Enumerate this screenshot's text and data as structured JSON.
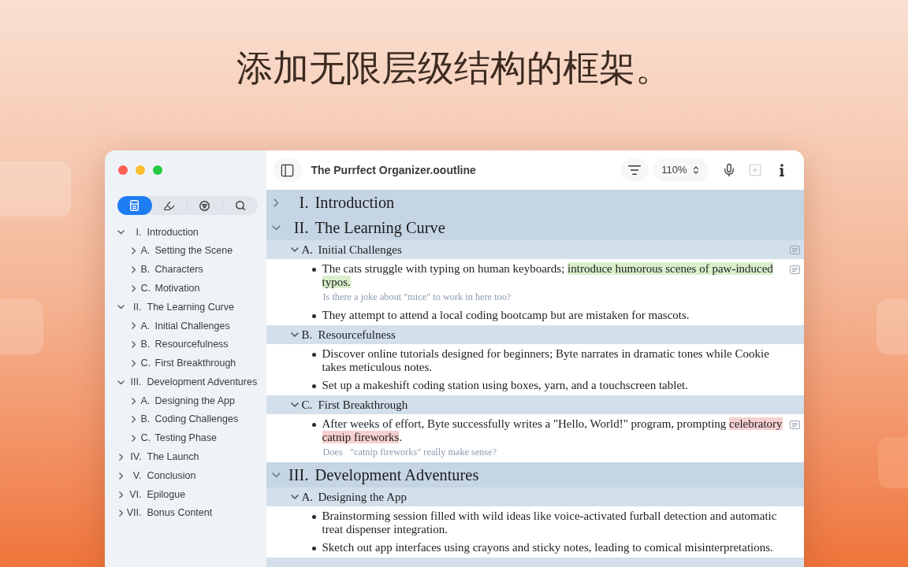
{
  "headline": "添加无限层级结构的框架。",
  "window": {
    "title": "The Purrfect Organizer.ooutline",
    "zoom": "110%",
    "add_button": {
      "disabled": true
    }
  },
  "sidebar": {
    "tabs": [
      {
        "kind": "outline",
        "selected": true
      },
      {
        "kind": "highlights",
        "selected": false
      },
      {
        "kind": "filter",
        "selected": false
      },
      {
        "kind": "search",
        "selected": false
      }
    ],
    "items": [
      {
        "number": "I.",
        "label": "Introduction",
        "expanded": true,
        "children": [
          {
            "number": "A.",
            "label": "Setting the Scene",
            "expanded": false
          },
          {
            "number": "B.",
            "label": "Characters",
            "expanded": false
          },
          {
            "number": "C.",
            "label": "Motivation",
            "expanded": false
          }
        ]
      },
      {
        "number": "II.",
        "label": "The Learning Curve",
        "expanded": true,
        "children": [
          {
            "number": "A.",
            "label": "Initial Challenges",
            "expanded": false
          },
          {
            "number": "B.",
            "label": "Resourcefulness",
            "expanded": false
          },
          {
            "number": "C.",
            "label": "First Breakthrough",
            "expanded": false
          }
        ]
      },
      {
        "number": "III.",
        "label": "Development Adventures",
        "expanded": true,
        "children": [
          {
            "number": "A.",
            "label": "Designing the App",
            "expanded": false
          },
          {
            "number": "B.",
            "label": "Coding Challenges",
            "expanded": false
          },
          {
            "number": "C.",
            "label": "Testing Phase",
            "expanded": false
          }
        ]
      },
      {
        "number": "IV.",
        "label": "The Launch",
        "expanded": false
      },
      {
        "number": "V.",
        "label": "Conclusion",
        "expanded": false
      },
      {
        "number": "VI.",
        "label": "Epilogue",
        "expanded": false
      },
      {
        "number": "VII.",
        "label": "Bonus Content",
        "expanded": false
      }
    ]
  },
  "outline": [
    {
      "number": "I.",
      "title": "Introduction",
      "expanded": false
    },
    {
      "number": "II.",
      "title": "The Learning Curve",
      "expanded": true,
      "children": [
        {
          "number": "A.",
          "title": "Initial Challenges",
          "expanded": true,
          "has_note": true,
          "children": [
            {
              "segments": [
                {
                  "text": "The cats struggle with typing on human keyboards; "
                },
                {
                  "text": "introduce humorous scenes of paw-induced typos.",
                  "color": "#d9efcc"
                }
              ],
              "has_note": true,
              "note": "Is there a joke about \"mice\" to work in here too?"
            },
            {
              "segments": [
                {
                  "text": "They attempt to attend a local coding bootcamp but are mistaken for mascots."
                }
              ],
              "has_note": false
            }
          ]
        },
        {
          "number": "B.",
          "title": "Resourcefulness",
          "expanded": true,
          "has_note": false,
          "children": [
            {
              "segments": [
                {
                  "text": "Discover online tutorials designed for beginners; Byte narrates in dramatic tones while Cookie takes meticulous notes."
                }
              ],
              "has_note": false
            },
            {
              "segments": [
                {
                  "text": "Set up a makeshift coding station using boxes, yarn, and a touchscreen tablet."
                }
              ],
              "has_note": false
            }
          ]
        },
        {
          "number": "C.",
          "title": "First Breakthrough",
          "expanded": true,
          "has_note": false,
          "children": [
            {
              "segments": [
                {
                  "text": "After weeks of effort, Byte successfully writes a \"Hello, World!\" program, prompting "
                },
                {
                  "text": "celebratory catnip fireworks",
                  "color": "#f6d0d0"
                },
                {
                  "text": "."
                }
              ],
              "has_note": true,
              "note": "Does   \"catnip fireworks\" really make sense?"
            }
          ]
        }
      ]
    },
    {
      "number": "III.",
      "title": "Development Adventures",
      "expanded": true,
      "children": [
        {
          "number": "A.",
          "title": "Designing the App",
          "expanded": true,
          "has_note": false,
          "children": [
            {
              "segments": [
                {
                  "text": "Brainstorming session filled with wild ideas like voice-activated furball detection and automatic treat dispenser integration."
                }
              ],
              "has_note": false
            },
            {
              "segments": [
                {
                  "text": "Sketch out app interfaces using crayons and sticky notes, leading to comical misinterpretations."
                }
              ],
              "has_note": false
            }
          ]
        }
      ]
    }
  ]
}
